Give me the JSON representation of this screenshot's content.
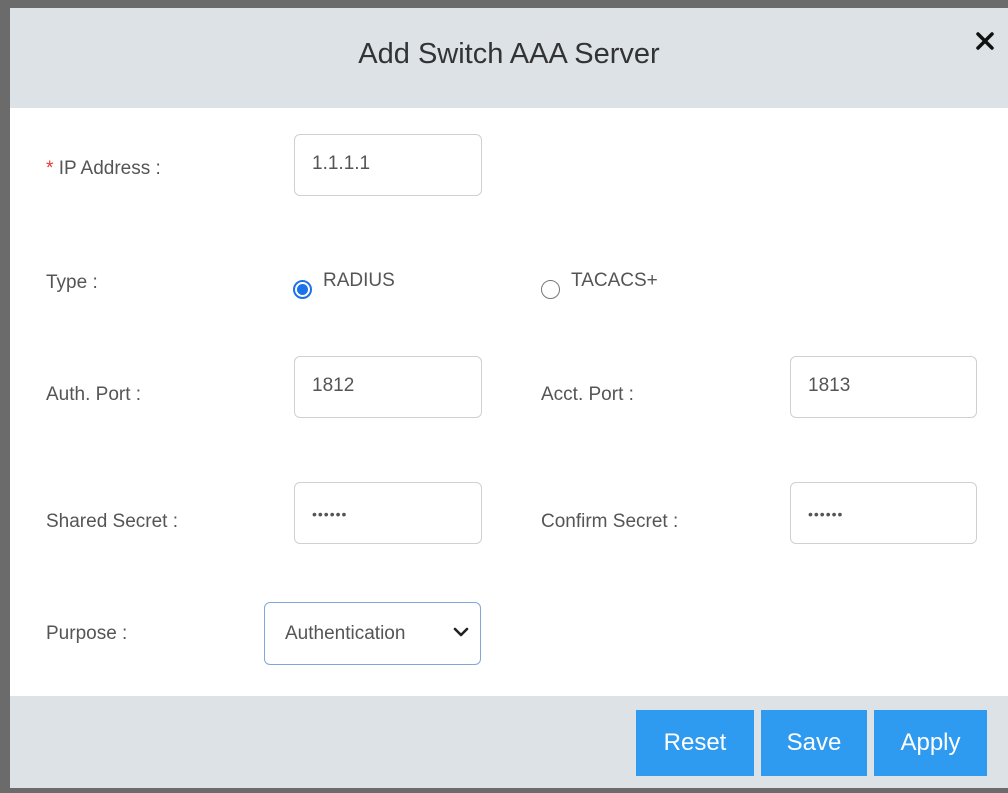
{
  "dialog": {
    "title": "Add Switch AAA Server",
    "close_icon": "close-icon"
  },
  "form": {
    "ip_address": {
      "required_mark": "*",
      "label": "IP Address :",
      "value": "1.1.1.1"
    },
    "type": {
      "label": "Type :",
      "options": [
        {
          "label": "RADIUS",
          "selected": true
        },
        {
          "label": "TACACS+",
          "selected": false
        }
      ]
    },
    "auth_port": {
      "label": "Auth. Port :",
      "value": "1812"
    },
    "acct_port": {
      "label": "Acct. Port :",
      "value": "1813"
    },
    "shared_secret": {
      "label": "Shared Secret :",
      "value": "••••••"
    },
    "confirm_secret": {
      "label": "Confirm Secret :",
      "value": "••••••"
    },
    "purpose": {
      "label": "Purpose :",
      "selected": "Authentication"
    }
  },
  "footer": {
    "reset_label": "Reset",
    "save_label": "Save",
    "apply_label": "Apply"
  },
  "colors": {
    "header_bg": "#dde2e7",
    "button_bg": "#2f9bf0",
    "radio_accent": "#1a73e8",
    "required": "#e53935"
  }
}
